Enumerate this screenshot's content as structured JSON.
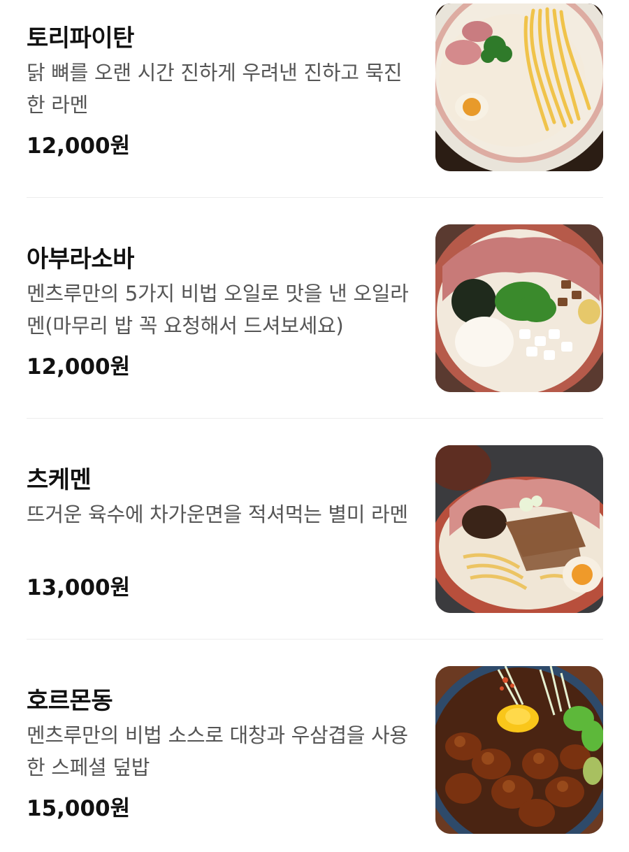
{
  "menu": {
    "items": [
      {
        "name": "토리파이탄",
        "description": "닭 뼈를 오랜 시간 진하게 우려낸 진하고 묵진한 라멘",
        "price": "12,000원",
        "photo_icon": "ramen-photo"
      },
      {
        "name": "아부라소바",
        "description": "멘츠루만의 5가지 비법 오일로 맛을 낸 오일라멘(마무리 밥 꼭 요청해서 드셔보세요)",
        "price": "12,000원",
        "photo_icon": "ramen-photo"
      },
      {
        "name": "츠케멘",
        "description": "뜨거운 육수에 차가운면을 적셔먹는 별미 라멘",
        "price": "13,000원",
        "photo_icon": "ramen-photo"
      },
      {
        "name": "호르몬동",
        "description": "멘츠루만의 비법 소스로 대창과 우삼겹을 사용한 스페셜 덮밥",
        "price": "15,000원",
        "photo_icon": "rice-bowl-photo"
      }
    ]
  }
}
